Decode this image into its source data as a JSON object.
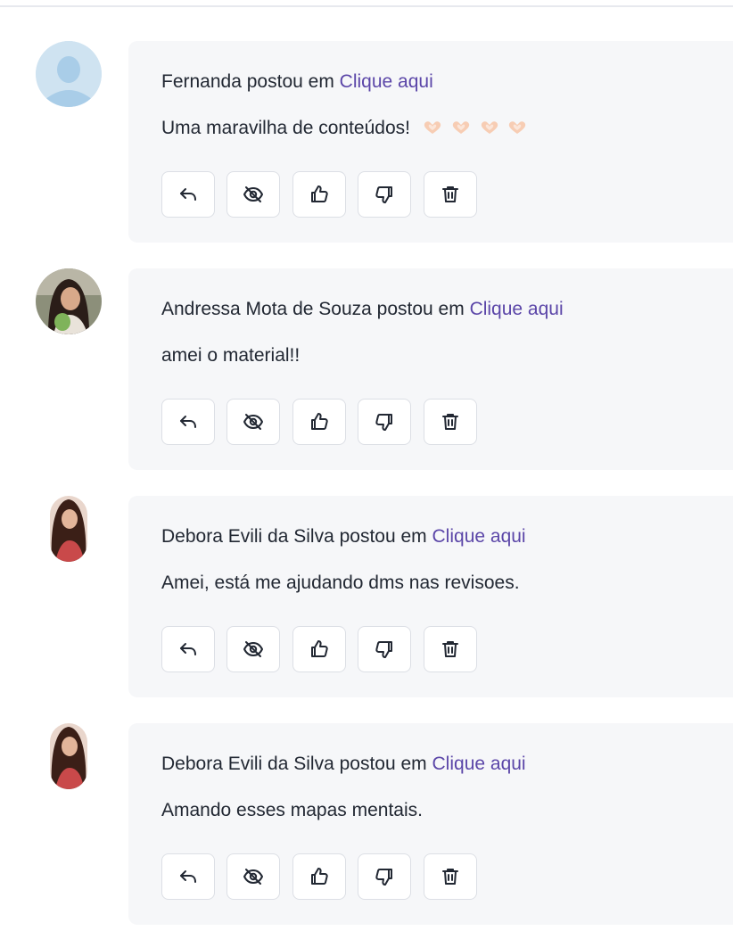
{
  "comments": [
    {
      "author": "Fernanda",
      "verb": "postou em",
      "link": "Clique aqui",
      "text": "Uma maravilha de conteúdos!",
      "emoji": "hands-heart x4",
      "avatar": "placeholder"
    },
    {
      "author": "Andressa Mota de Souza",
      "verb": "postou em",
      "link": "Clique aqui",
      "text": "amei o material!!",
      "avatar": "photo"
    },
    {
      "author": "Debora Evili da Silva",
      "verb": "postou em",
      "link": "Clique aqui",
      "text": "Amei, está me ajudando dms nas revisoes.",
      "avatar": "photo"
    },
    {
      "author": "Debora Evili da Silva",
      "verb": "postou em",
      "link": "Clique aqui",
      "text": "Amando esses mapas mentais.",
      "avatar": "photo"
    }
  ],
  "actions": [
    "reply-icon",
    "hide-icon",
    "thumbs-up-icon",
    "thumbs-down-icon",
    "trash-icon"
  ],
  "colors": {
    "link": "#5b46a8",
    "card_bg": "#f6f7f9",
    "button_border": "#dcdfe5"
  }
}
